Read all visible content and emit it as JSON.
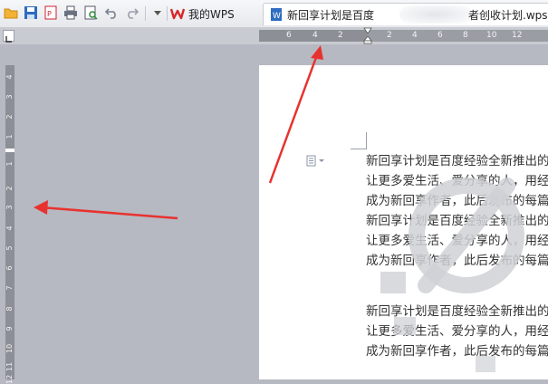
{
  "toolbar": {
    "icons": [
      "folder-open-icon",
      "save-icon",
      "pdf-export-icon",
      "print-icon",
      "print-preview-icon",
      "undo-icon",
      "redo-icon",
      "dropdown-icon"
    ]
  },
  "tabs": {
    "home_label": "我的WPS",
    "doc_label_start": "新回享计划是百度",
    "doc_label_end": "者创收计划.wps"
  },
  "ruler": {
    "horizontal_ticks": [
      "6",
      "4",
      "2",
      "2",
      "4",
      "6",
      "8",
      "10",
      "12"
    ],
    "vertical_ticks": [
      "4",
      "3",
      "2",
      "1",
      "1",
      "2",
      "3",
      "4",
      "5",
      "6",
      "7",
      "8",
      "9",
      "10",
      "11",
      "12"
    ]
  },
  "document": {
    "paragraph1": [
      "新回享计划是百度经验全新推出的",
      "让更多爱生活、爱分享的人，用经",
      "成为新回享作者，此后发布的每篇"
    ],
    "paragraph2": [
      "新回享计划是百度经验全新推出的",
      "让更多爱生活、爱分享的人，用经",
      "成为新回享作者，此后发布的每篇"
    ],
    "paragraph3": [
      "新回享计划是百度经验全新推出的",
      "让更多爱生活、爱分享的人，用经",
      "成为新回享作者，此后发布的每篇"
    ]
  },
  "colors": {
    "annotation_arrow": "#e8322f",
    "wps_logo": "#d7262a",
    "ruler": "#8c8f96",
    "workspace": "#b6b9c2"
  }
}
